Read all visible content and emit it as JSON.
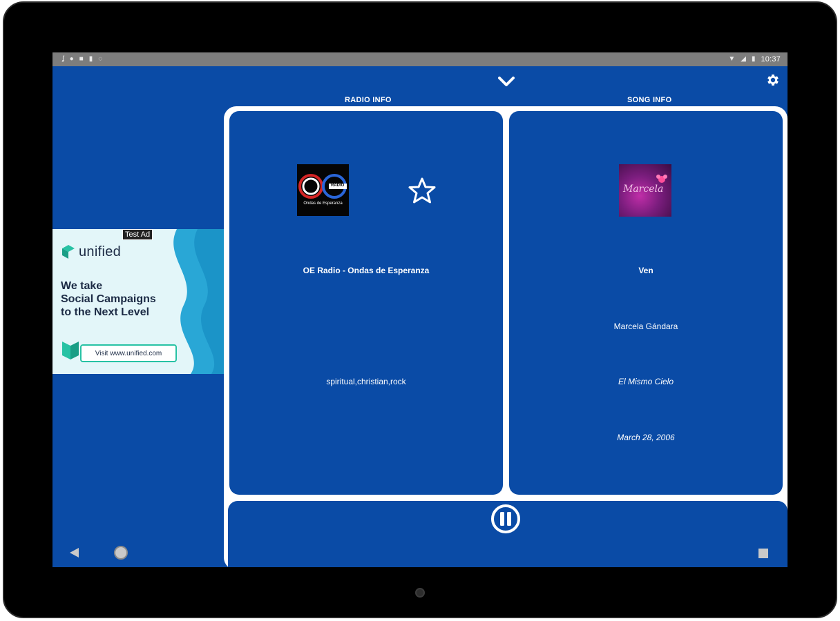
{
  "status_bar": {
    "time": "10:37",
    "left_icons": [
      "signal-a-icon",
      "android-icon",
      "download-icon",
      "sd-card-icon",
      "sync-icon"
    ],
    "right_icons": [
      "wifi-icon",
      "cell-signal-icon",
      "battery-icon"
    ]
  },
  "header": {
    "radio_section_label": "RADIO INFO",
    "song_section_label": "SONG INFO",
    "collapse_icon": "chevron-down-icon",
    "settings_icon": "gear-icon"
  },
  "radio": {
    "logo_text": "Ondas de Esperanza",
    "logo_badge": "RADIO",
    "station_name": "OE Radio - Ondas de Esperanza",
    "tags": "spiritual,christian,rock",
    "favorite_icon": "star-outline-icon"
  },
  "song": {
    "album_art_text": "Marcela",
    "title": "Ven",
    "artist": "Marcela Gándara",
    "album": "El Mismo Cielo",
    "date": "March 28, 2006"
  },
  "player": {
    "pause_icon": "pause-icon"
  },
  "ad": {
    "badge": "Test Ad",
    "brand": "unified",
    "headline": [
      "We take",
      "Social Campaigns",
      "to the Next Level"
    ],
    "cta": "Visit www.unified.com"
  },
  "colors": {
    "app_background": "#0a4ba6",
    "card_border": "#ffffff",
    "status_bar": "#7d7d7d",
    "ad_background": "#e3f6f9",
    "ad_accent": "#27c2a4"
  },
  "nav_bar": {
    "icons": [
      "back-icon",
      "home-icon",
      "recents-icon"
    ]
  }
}
